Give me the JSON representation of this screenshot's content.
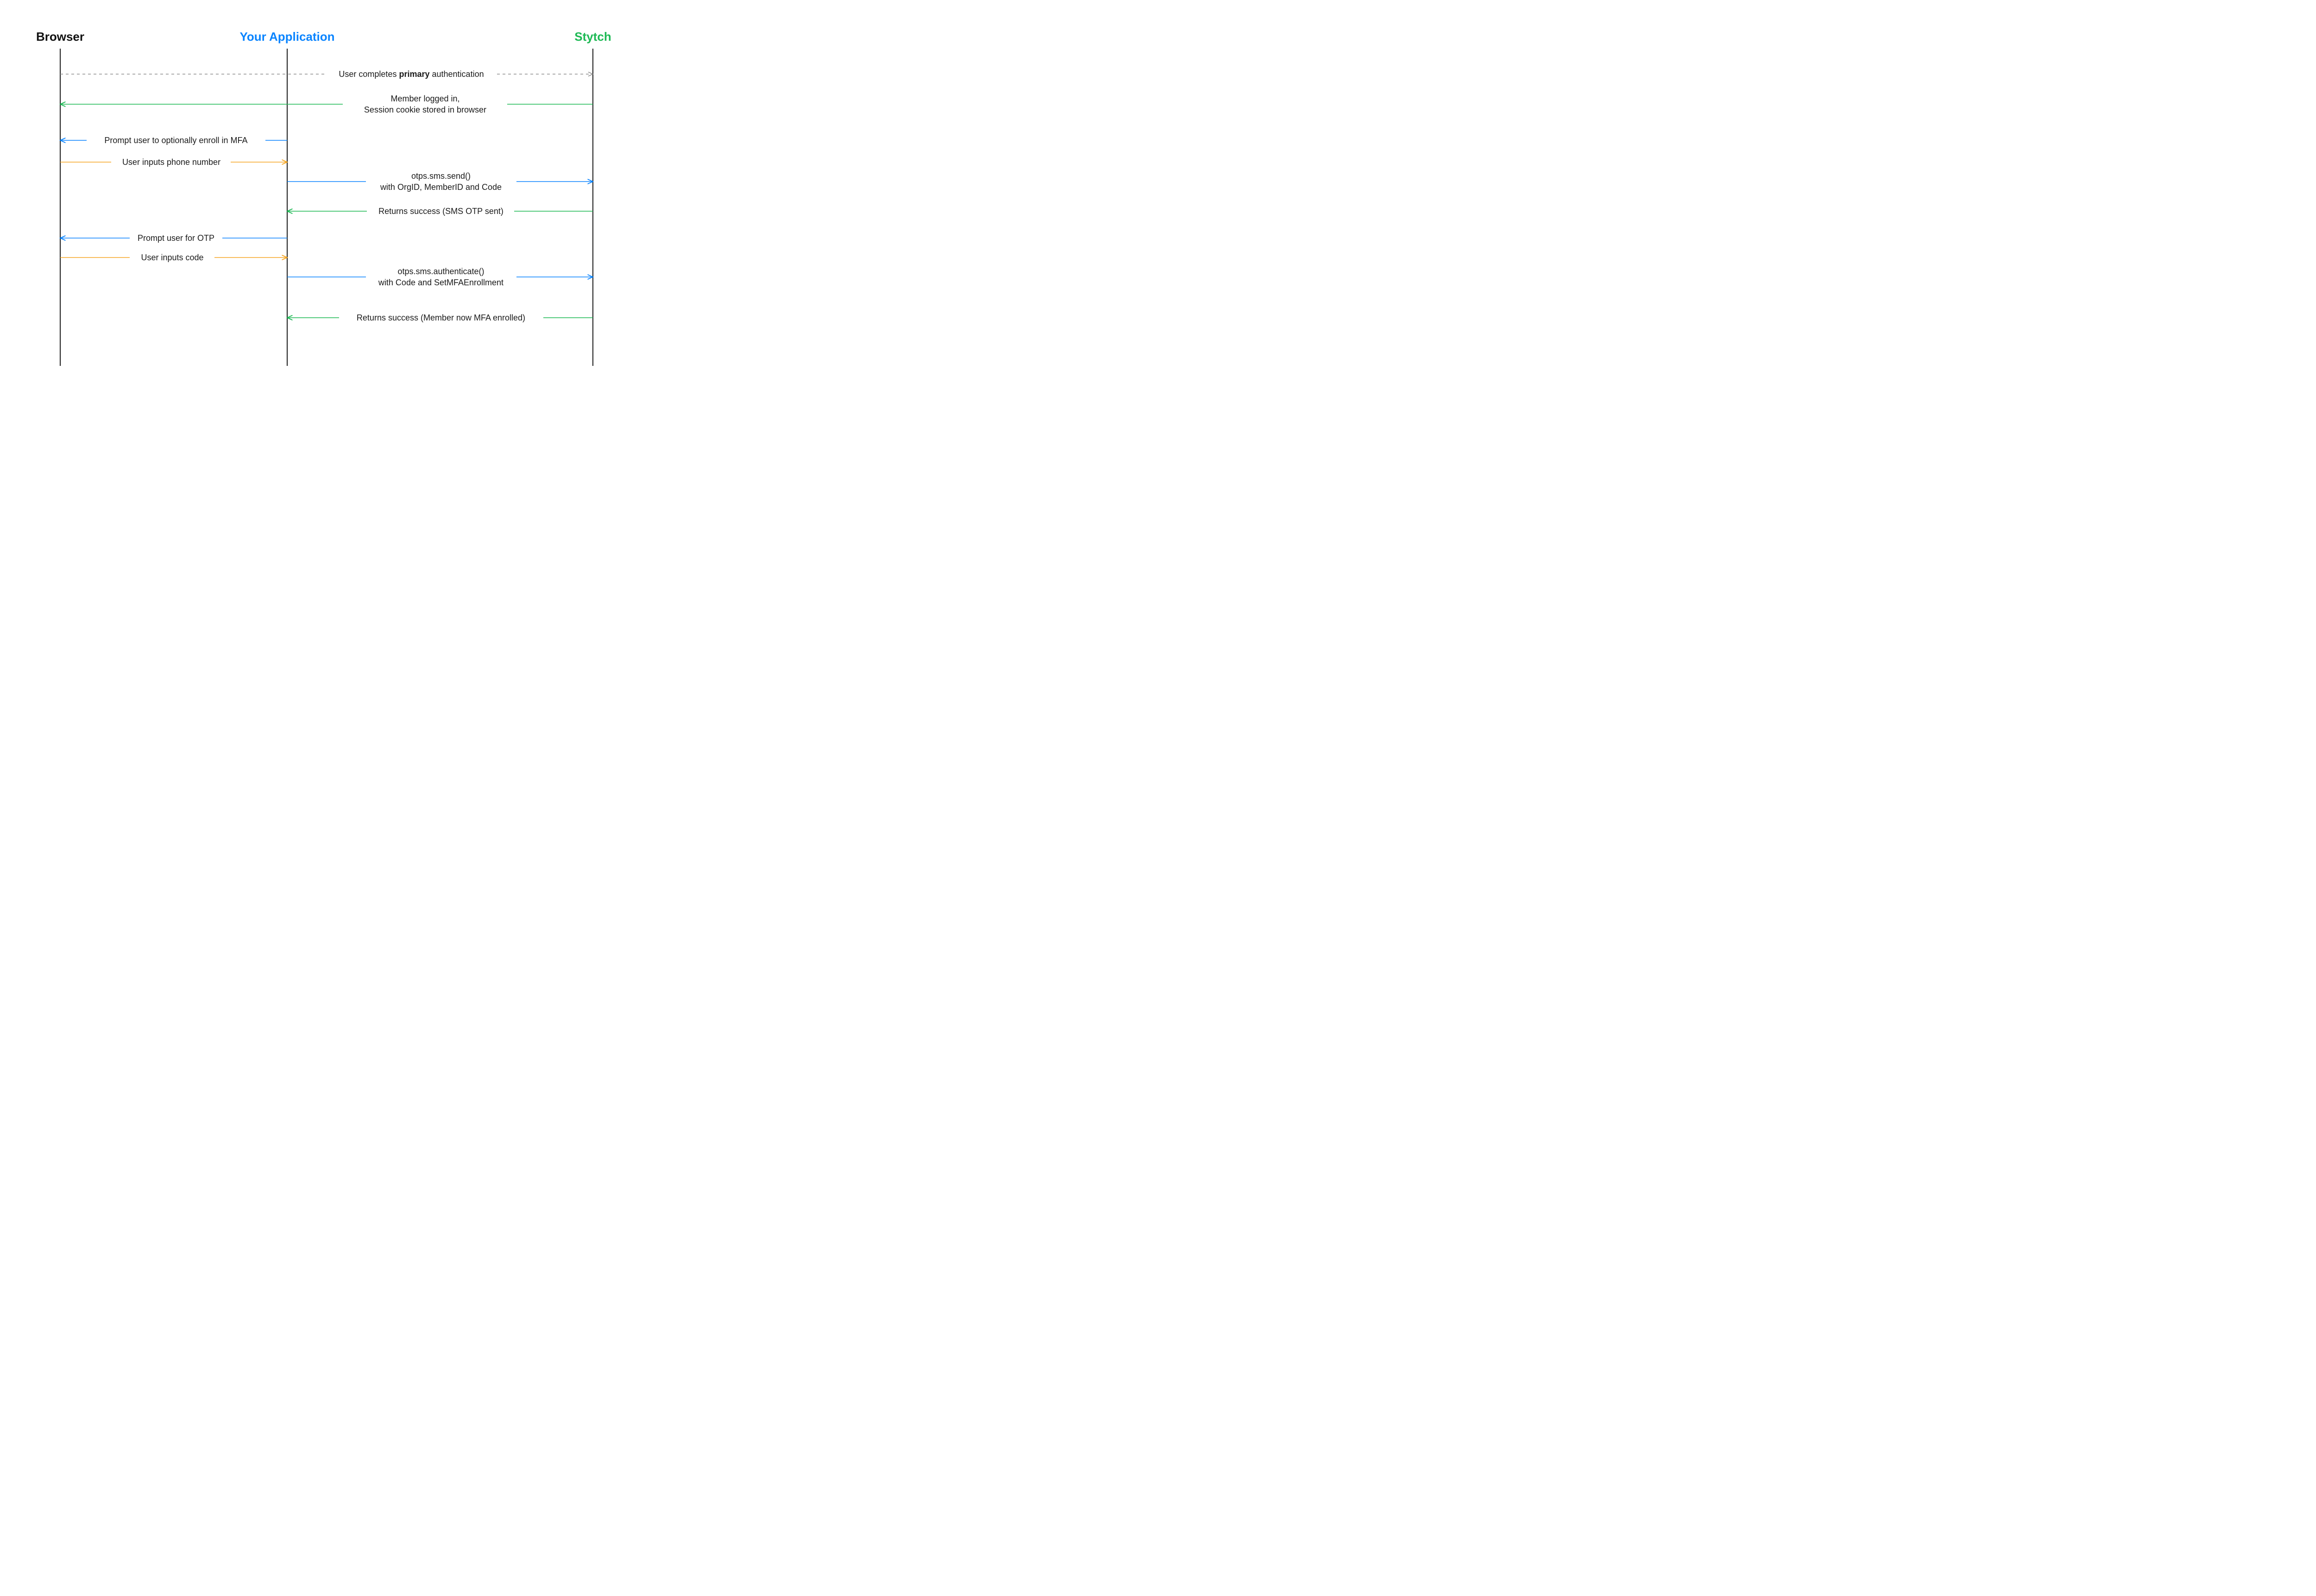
{
  "actors": {
    "browser": {
      "label": "Browser",
      "color": "#111111"
    },
    "app": {
      "label": "Your Application",
      "color": "#0a84ff"
    },
    "stytch": {
      "label": "Stytch",
      "color": "#1db954"
    }
  },
  "colors": {
    "lifeline": "#1a1a1a",
    "dashed": "#8e8e8e",
    "green": "#1db954",
    "blue": "#0a84ff",
    "orange": "#f5a623"
  },
  "messages": {
    "m1a": "User completes ",
    "m1b": "primary",
    "m1c": " authentication",
    "m2a": "Member logged in,",
    "m2b": "Session cookie stored in browser",
    "m3": "Prompt user to optionally enroll in MFA",
    "m4": "User inputs phone number",
    "m5a": "otps.sms.send()",
    "m5b": "with OrgID, MemberID and Code",
    "m6": "Returns success (SMS OTP sent)",
    "m7": "Prompt user for OTP",
    "m8": "User inputs code",
    "m9a": "otps.sms.authenticate()",
    "m9b": "with Code and SetMFAEnrollment",
    "m10": "Returns success (Member now MFA enrolled)"
  }
}
